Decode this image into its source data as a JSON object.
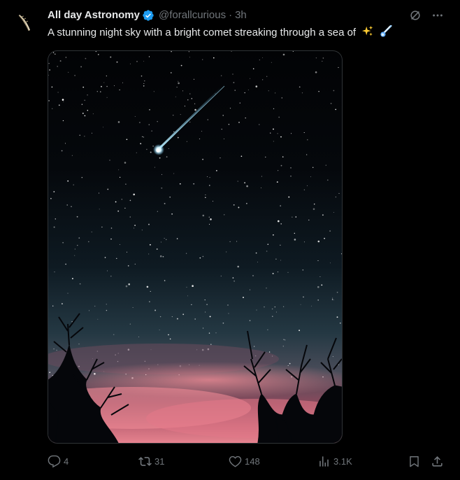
{
  "tweet": {
    "display_name": "All day Astronomy",
    "handle": "@forallcurious",
    "separator": "·",
    "time": "3h",
    "text": "A stunning night sky with a bright comet streaking through a sea of",
    "emojis": [
      "sparkles-emoji",
      "comet-emoji"
    ],
    "verified": true
  },
  "icons": {
    "grok": "grok-icon",
    "more": "more-icon"
  },
  "actions": {
    "replies": "4",
    "reposts": "31",
    "likes": "148",
    "views": "3.1K"
  },
  "colors": {
    "background": "#000000",
    "text": "#e7e9ea",
    "muted": "#71767b",
    "verified": "#1d9bf0"
  }
}
